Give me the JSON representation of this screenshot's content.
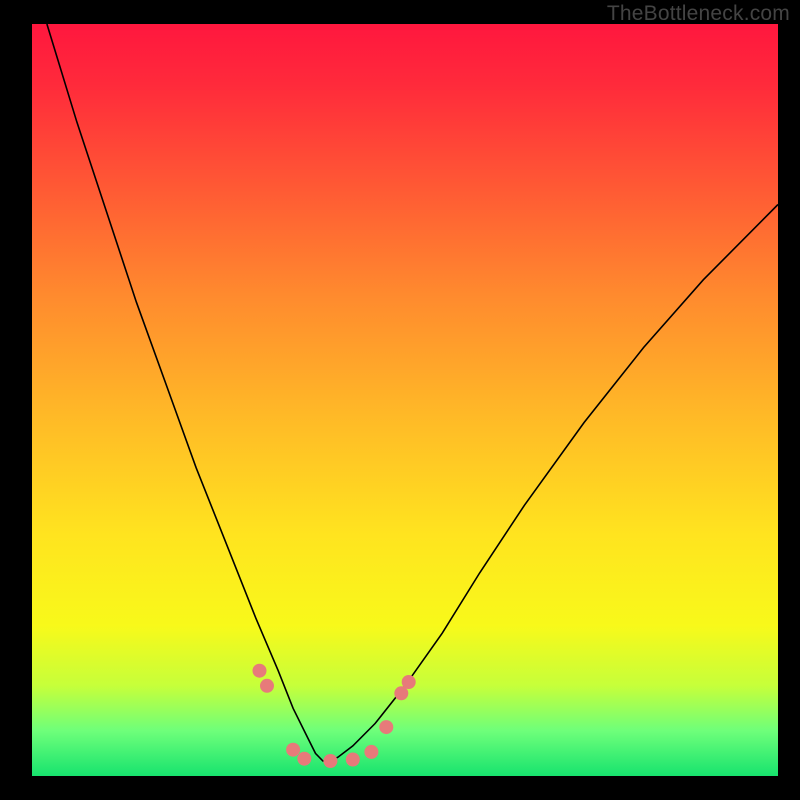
{
  "watermark": "TheBottleneck.com",
  "colors": {
    "frame": "#000000",
    "gradient_start": "#ff173e",
    "gradient_end": "#17e36e",
    "curve": "#000000",
    "dot": "#e77a7a"
  },
  "chart_data": {
    "type": "line",
    "title": "",
    "xlabel": "",
    "ylabel": "",
    "xlim": [
      0,
      100
    ],
    "ylim": [
      0,
      100
    ],
    "series": [
      {
        "name": "bottleneck-curve",
        "x": [
          2,
          6,
          10,
          14,
          18,
          22,
          26,
          30,
          33,
          35,
          37,
          38,
          39,
          40,
          41,
          43,
          46,
          50,
          55,
          60,
          66,
          74,
          82,
          90,
          100
        ],
        "y": [
          100,
          87,
          75,
          63,
          52,
          41,
          31,
          21,
          14,
          9,
          5,
          3,
          2,
          2,
          2.5,
          4,
          7,
          12,
          19,
          27,
          36,
          47,
          57,
          66,
          76
        ]
      }
    ],
    "markers": [
      {
        "x": 30.5,
        "y": 14
      },
      {
        "x": 31.5,
        "y": 12
      },
      {
        "x": 35.0,
        "y": 3.5
      },
      {
        "x": 36.5,
        "y": 2.3
      },
      {
        "x": 40.0,
        "y": 2
      },
      {
        "x": 43.0,
        "y": 2.2
      },
      {
        "x": 45.5,
        "y": 3.2
      },
      {
        "x": 47.5,
        "y": 6.5
      },
      {
        "x": 49.5,
        "y": 11
      },
      {
        "x": 50.5,
        "y": 12.5
      }
    ]
  }
}
